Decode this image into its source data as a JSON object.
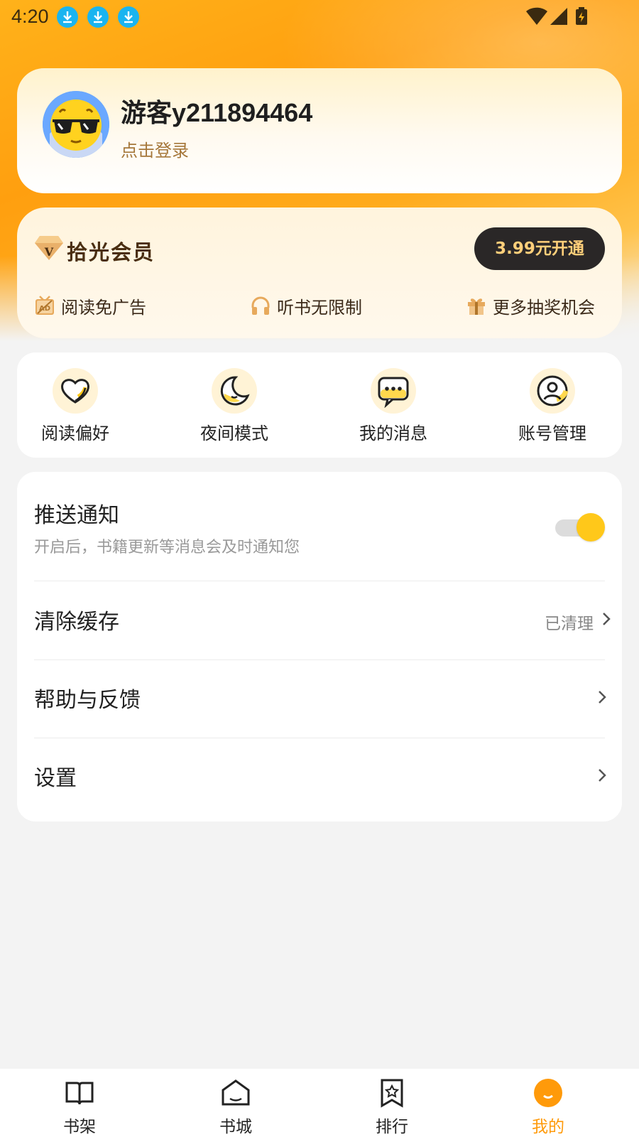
{
  "status_bar": {
    "time": "4:20",
    "icons": [
      "download-icon",
      "download-icon",
      "download-icon",
      "wifi-icon",
      "signal-icon",
      "battery-charging-icon"
    ]
  },
  "profile": {
    "username": "游客y211894464",
    "login_label": "点击登录",
    "avatar_icon": "sunglasses-face-avatar"
  },
  "vip": {
    "title": "拾光会员",
    "button_label": "3.99元开通",
    "perks": [
      {
        "icon": "ad-free-icon",
        "label": "阅读免广告"
      },
      {
        "icon": "headphones-icon",
        "label": "听书无限制"
      },
      {
        "icon": "gift-icon",
        "label": "更多抽奖机会"
      }
    ]
  },
  "quick_actions": [
    {
      "icon": "heart-icon",
      "label": "阅读偏好"
    },
    {
      "icon": "moon-icon",
      "label": "夜间模式"
    },
    {
      "icon": "message-icon",
      "label": "我的消息"
    },
    {
      "icon": "account-icon",
      "label": "账号管理"
    }
  ],
  "settings": {
    "push": {
      "title": "推送通知",
      "subtitle": "开启后，书籍更新等消息会及时通知您",
      "enabled": true
    },
    "cache": {
      "title": "清除缓存",
      "value": "已清理"
    },
    "help": {
      "title": "帮助与反馈"
    },
    "settings": {
      "title": "设置"
    }
  },
  "bottom_nav": [
    {
      "icon": "bookshelf-icon",
      "label": "书架",
      "active": false
    },
    {
      "icon": "bookstore-icon",
      "label": "书城",
      "active": false
    },
    {
      "icon": "ranking-icon",
      "label": "排行",
      "active": false
    },
    {
      "icon": "profile-icon",
      "label": "我的",
      "active": true
    }
  ],
  "colors": {
    "accent": "#ff9a0a",
    "toggle_on": "#ffc81a",
    "vip_button_bg": "#2a2727",
    "vip_button_text": "#ffcf7a"
  }
}
